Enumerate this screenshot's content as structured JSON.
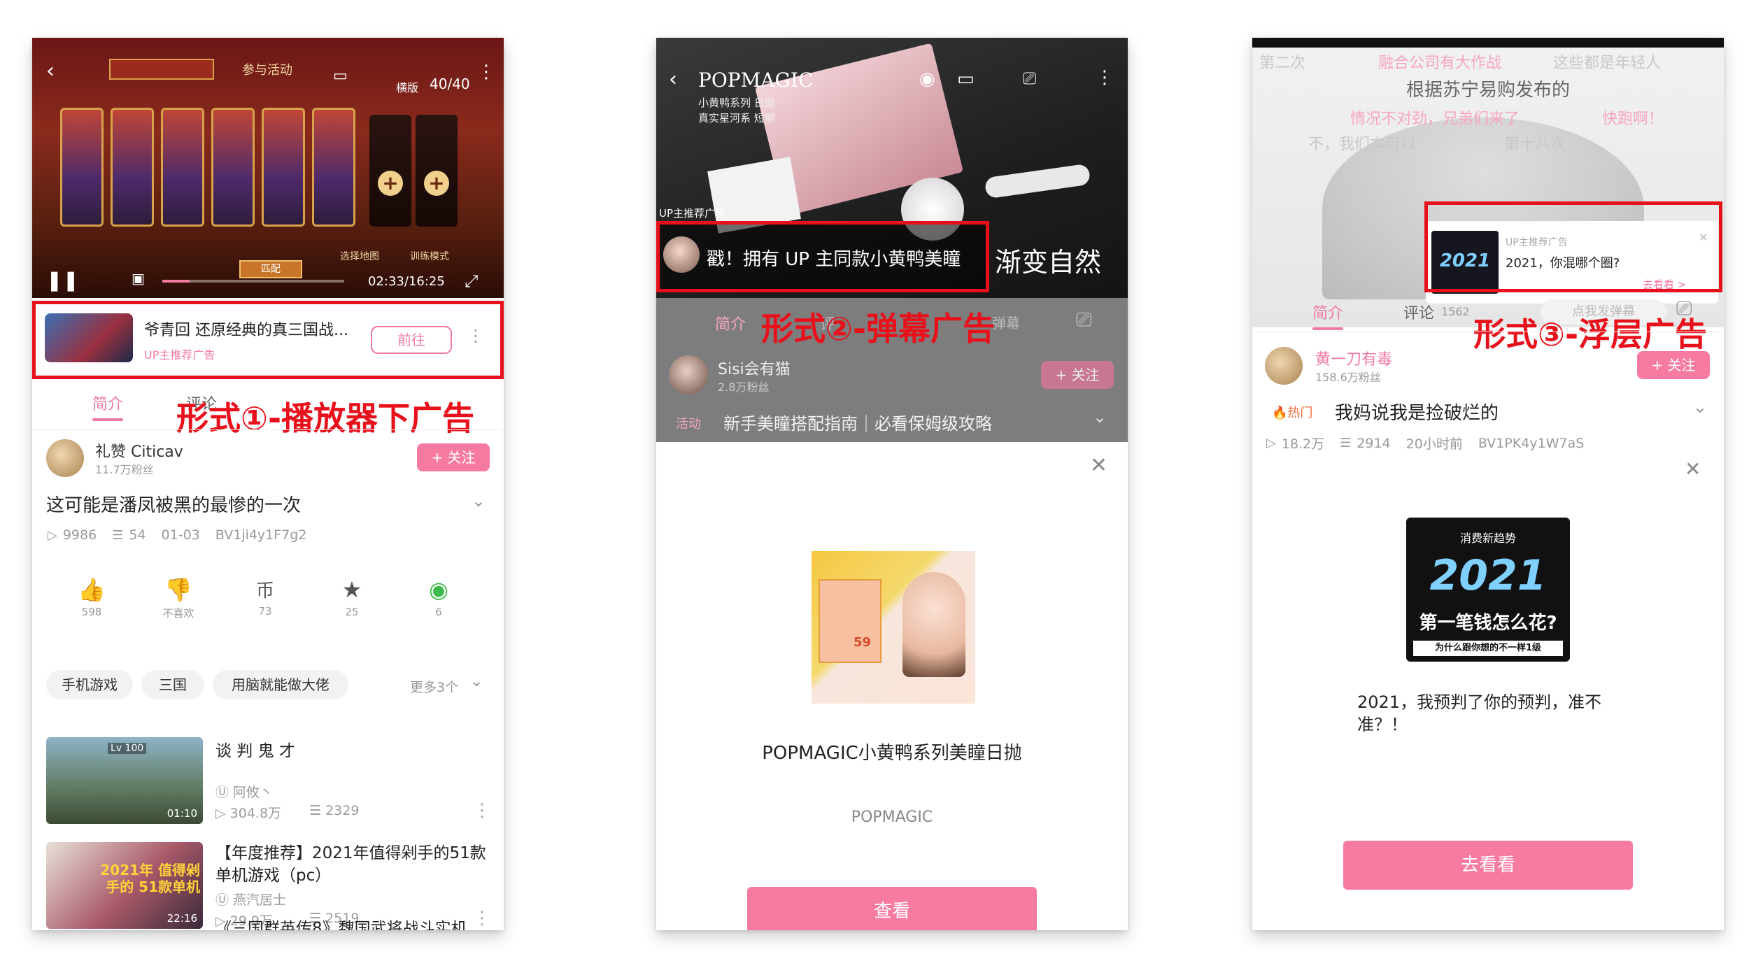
{
  "phone1": {
    "video": {
      "top_label": "参与活动",
      "page_counter": "40/40",
      "mode_label": "横版",
      "match_label": "匹配",
      "time": "02:33/16:25",
      "select_map": "选择地图",
      "training_mode": "训练模式"
    },
    "ad": {
      "title": "爷青回  还原经典的真三国战...",
      "tag": "UP主推荐广告",
      "button": "前往"
    },
    "caption": "形式①-播放器下广告",
    "tabs": [
      "简介",
      "评论"
    ],
    "uploader": {
      "name": "礼赞 Citicav",
      "fans": "11.7万粉丝",
      "follow": "+ 关注"
    },
    "video_title": "这可能是潘凤被黑的最惨的一次",
    "meta": {
      "views": "9986",
      "comments": "54",
      "date": "01-03",
      "bvid": "BV1ji4y1F7g2"
    },
    "actions": [
      {
        "icon": "👍",
        "label": "598"
      },
      {
        "icon": "👎",
        "label": "不喜欢"
      },
      {
        "icon": "币",
        "label": "73"
      },
      {
        "icon": "★",
        "label": "25"
      },
      {
        "icon": "◉",
        "label": "6"
      }
    ],
    "tags": [
      "手机游戏",
      "三国",
      "用脑就能做大佬"
    ],
    "more_tags": "更多3个",
    "recommendations": [
      {
        "title": "谈 判 鬼 才",
        "author": "阿攸丶",
        "views": "304.8万",
        "comments": "2329",
        "duration": "01:10",
        "thumb_text": "Lv 100"
      },
      {
        "title": "【年度推荐】2021年值得剁手的51款单机游戏（pc）",
        "author": "燕汽居士",
        "views": "29.9万",
        "comments": "2519",
        "duration": "22:16",
        "thumb_text": "2021年 值得剁手的 51款单机"
      },
      {
        "title": "《三国群英传8》魏国武将战斗实机",
        "author": "",
        "views": "",
        "comments": "",
        "duration": "",
        "thumb_text": ""
      }
    ]
  },
  "phone2": {
    "video": {
      "brand": "POPMAGIC",
      "subline1": "小黄鸭系列 日抛",
      "subline2": "真实星河系 短期",
      "up_tag": "UP主推荐广告",
      "side_text": "渐变自然"
    },
    "danmu": "戳！拥有 UP 主同款小黄鸭美瞳",
    "caption": "形式②-弹幕广告",
    "tabs": [
      "简介",
      "评",
      "弹幕"
    ],
    "uploader": {
      "name": "Sisi会有猫",
      "fans": "2.8万粉丝",
      "follow": "+ 关注"
    },
    "activity": {
      "tag": "活动",
      "title": "新手美瞳搭配指南｜必看保姆级攻略"
    },
    "sheet": {
      "product_title": "POPMAGIC小黄鸭系列美瞳日抛",
      "brand": "POPMAGIC",
      "button": "查看",
      "promo_price": "59"
    }
  },
  "phone3": {
    "video": {
      "headline": "根据苏宁易购发布的",
      "danmaku_lines": [
        "融合公司有大作战",
        "这些都是年轻人",
        "情况不对劲，兄弟们来了",
        "快跑啊！",
        "不，我们本可以",
        "第二次",
        "第十八次"
      ]
    },
    "float_ad": {
      "tag": "UP主推荐广告",
      "title": "2021，你混哪个圈?",
      "link": "去看看 >",
      "thumb_year": "2021"
    },
    "caption": "形式③-浮层广告",
    "tabs": [
      "简介",
      "评论"
    ],
    "comment_count": "1562",
    "danmaku_placeholder": "点我发弹幕",
    "uploader": {
      "name": "黄一刀有毒",
      "fans": "158.6万粉丝",
      "follow": "+ 关注"
    },
    "hot_tag": "热门",
    "video_title": "我妈说我是捡破烂的",
    "meta": {
      "views": "18.2万",
      "comments": "2914",
      "time": "20小时前",
      "bvid": "BV1PK4y1W7aS"
    },
    "promo": {
      "top": "消费新趋势",
      "year": "2021",
      "line": "第一笔钱怎么花?",
      "bottom": "为什么跟你想的不一样1级"
    },
    "ad_text": "2021，我预判了你的预判，准不准？！",
    "button": "去看看"
  }
}
